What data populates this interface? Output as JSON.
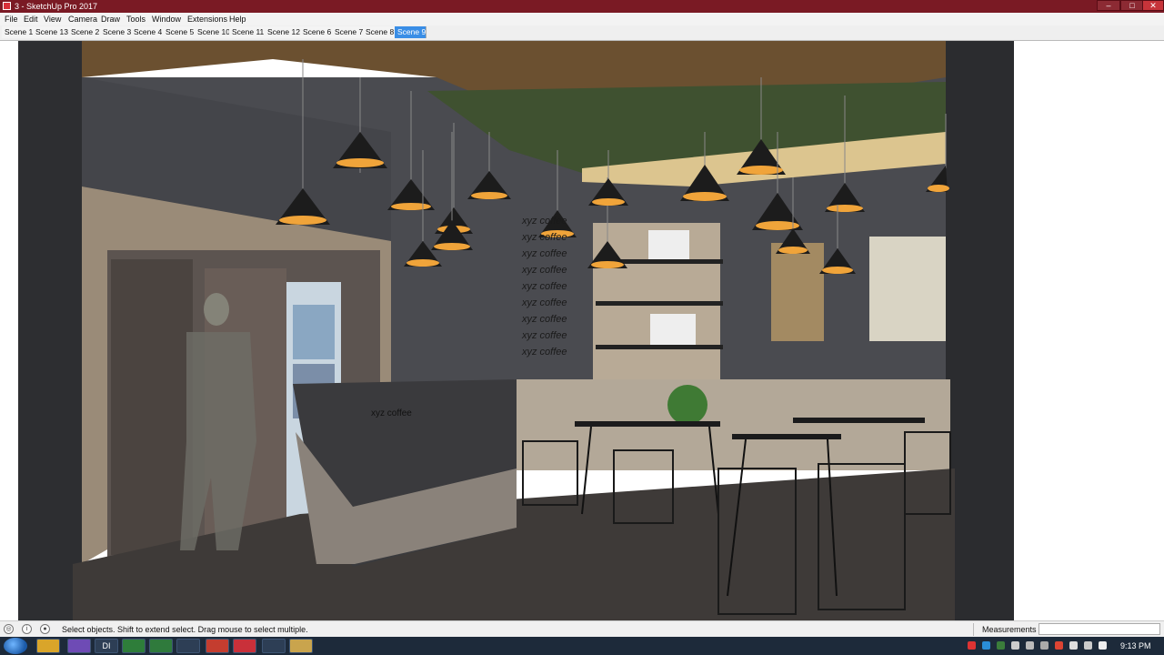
{
  "window": {
    "title": "3 - SketchUp Pro 2017",
    "controls": {
      "minimize": "–",
      "maximize": "□",
      "close": "✕"
    }
  },
  "menubar": {
    "items": [
      "File",
      "Edit",
      "View",
      "Camera",
      "Draw",
      "Tools",
      "Window",
      "Extensions",
      "Help"
    ]
  },
  "scenes": {
    "tabs": [
      "Scene 1",
      "Scene 13",
      "Scene 2",
      "Scene 3",
      "Scene 4",
      "Scene 5",
      "Scene 10",
      "Scene 11",
      "Scene 12",
      "Scene 6",
      "Scene 7",
      "Scene 8",
      "Scene 9"
    ],
    "active": "Scene 9"
  },
  "viewport": {
    "wall_signage": [
      "xyz coffee",
      "xyz coffee",
      "xyz coffee",
      "xyz coffee",
      "xyz coffee",
      "xyz coffee",
      "xyz coffee",
      "xyz coffee",
      "xyz coffee"
    ],
    "counter_sign": "xyz coffee",
    "colors": {
      "ceiling_brown": "#6b5030",
      "ceiling_green": "#3f5130",
      "ceiling_light": "#dcc58f",
      "wall_dark": "#4a4b50",
      "lamp_glow": "#f0a43a",
      "floor": "#3e3a38"
    }
  },
  "statusbar": {
    "message": "Select objects. Shift to extend select. Drag mouse to select multiple.",
    "measurements_label": "Measurements",
    "measurements_value": ""
  },
  "taskbar": {
    "apps": [
      "chrome-icon",
      "viber-icon",
      "dictionary-icon",
      "excel-icon",
      "word-icon",
      "monitor-icon",
      "autocad-icon",
      "sketchup-icon",
      "pdf-icon",
      "explorer-icon"
    ],
    "dict_label": "DI",
    "clock": "9:13 PM"
  }
}
